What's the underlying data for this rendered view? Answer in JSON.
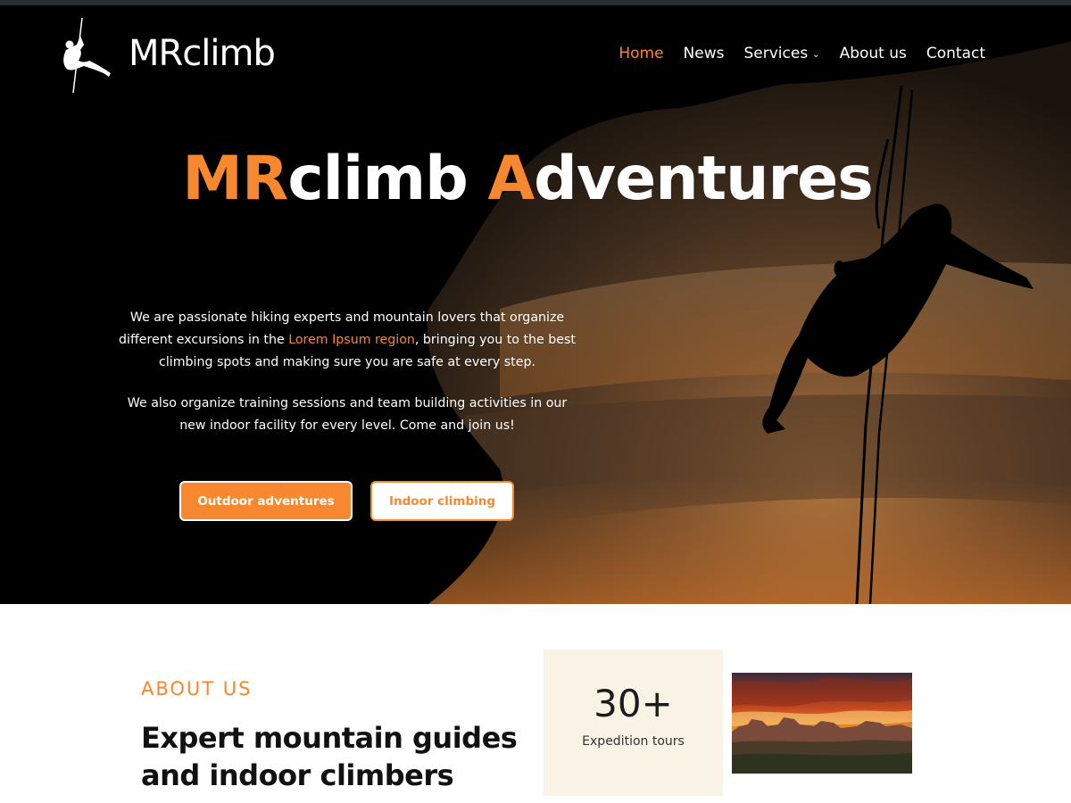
{
  "brand": {
    "name": "MRclimb"
  },
  "nav": {
    "items": [
      {
        "label": "Home",
        "active": true
      },
      {
        "label": "News",
        "active": false
      },
      {
        "label": "Services",
        "active": false,
        "has_dropdown": true
      },
      {
        "label": "About us",
        "active": false
      },
      {
        "label": "Contact",
        "active": false
      }
    ]
  },
  "hero": {
    "title_part1_accent": "MR",
    "title_part2": "climb ",
    "title_part3_accent": "A",
    "title_part4": "dventures",
    "para1_before": "We are passionate hiking experts and mountain lovers that organize different excursions in the ",
    "para1_highlight": "Lorem Ipsum region",
    "para1_after": ", bringing you to the best climbing spots and making sure you are safe at every step.",
    "para2": "We also organize training sessions and team building activities in our new indoor facility for every level. Come and join us!",
    "primary_button": "Outdoor adventures",
    "secondary_button": "Indoor climbing"
  },
  "about": {
    "eyebrow": "ABOUT US",
    "heading_line1": "Expert mountain guides",
    "heading_line2": "and indoor climbers"
  },
  "stat": {
    "value": "30+",
    "label": "Expedition tours"
  },
  "icons": {
    "logo": "climber-rappelling-icon",
    "dropdown": "chevron-down-icon"
  },
  "colors": {
    "accent": "#f7882f",
    "hero_bg": "#000000",
    "stat_card_bg": "#f8f3e4",
    "heading_text": "#111111"
  }
}
